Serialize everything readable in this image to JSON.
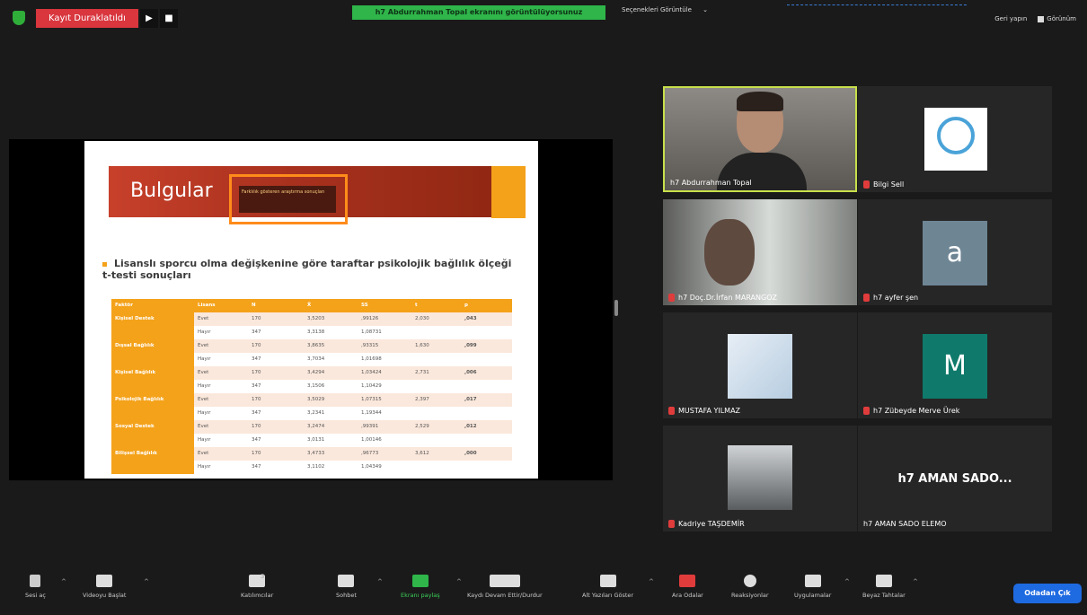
{
  "topbar": {
    "recording_label": "Kayıt Duraklatıldı",
    "play_glyph": "▶",
    "stop_glyph": "■",
    "screen_share_banner": "h7 Abdurrahman Topal ekranını görüntülüyorsunuz",
    "view_options": "Seçenekleri Görüntüle",
    "view_options_caret": "⌄",
    "exit_fullscreen": "Geri yapın",
    "view": "Görünüm"
  },
  "slide": {
    "title": "Bulgular",
    "header_box_text": "Farklılık gösteren araştırma sonuçları",
    "bullet": "Lisanslı sporcu olma değişkenine göre taraftar psikolojik bağlılık ölçeği t-testi sonuçları",
    "table": {
      "headers": [
        "Faktör",
        "Lisans",
        "N",
        "X̄",
        "SS",
        "t",
        "p"
      ],
      "rows": [
        [
          "Kişisel Destek",
          "Evet",
          "170",
          "3,5203",
          ",99126",
          "2,030",
          ",043"
        ],
        [
          "",
          "Hayır",
          "347",
          "3,3138",
          "1,08731",
          "",
          ""
        ],
        [
          "Dışsal Bağlılık",
          "Evet",
          "170",
          "3,8635",
          ",93315",
          "1,630",
          ",099"
        ],
        [
          "",
          "Hayır",
          "347",
          "3,7034",
          "1,01698",
          "",
          ""
        ],
        [
          "Kişisel Bağlılık",
          "Evet",
          "170",
          "3,4294",
          "1,03424",
          "2,731",
          ",006"
        ],
        [
          "",
          "Hayır",
          "347",
          "3,1506",
          "1,10429",
          "",
          ""
        ],
        [
          "Psikolojik Bağlılık",
          "Evet",
          "170",
          "3,5029",
          "1,07315",
          "2,397",
          ",017"
        ],
        [
          "",
          "Hayır",
          "347",
          "3,2341",
          "1,19344",
          "",
          ""
        ],
        [
          "Sosyal Destek",
          "Evet",
          "170",
          "3,2474",
          ",99391",
          "2,529",
          ",012"
        ],
        [
          "",
          "Hayır",
          "347",
          "3,0131",
          "1,00146",
          "",
          ""
        ],
        [
          "Bilişsel Bağlılık",
          "Evet",
          "170",
          "3,4733",
          ",96773",
          "3,612",
          ",000"
        ],
        [
          "",
          "Hayır",
          "347",
          "3,1102",
          "1,04349",
          "",
          ""
        ]
      ]
    }
  },
  "gallery": [
    {
      "name": "h7 Abdurrahman Topal",
      "muted": false
    },
    {
      "name": "Bilgi Sell",
      "muted": true
    },
    {
      "name": "h7 Doç.Dr.İrfan MARANGOZ",
      "muted": true
    },
    {
      "name": "h7 ayfer şen",
      "muted": true,
      "avatar_letter": "a"
    },
    {
      "name": "MUSTAFA YILMAZ",
      "muted": true
    },
    {
      "name": "h7 Zübeyde Merve Ürek",
      "muted": true,
      "avatar_letter": "M"
    },
    {
      "name": "Kadriye TAŞDEMİR",
      "muted": true
    },
    {
      "name": "h7 AMAN SADO ELEMO",
      "muted": false,
      "big_label": "h7 AMAN SADO..."
    }
  ],
  "toolbar": {
    "mic": "Sesi aç",
    "video": "Videoyu Başlat",
    "participants": "Katılımcılar",
    "participants_count": "3",
    "chat": "Sohbet",
    "share": "Ekranı paylaş",
    "record": "Kaydı Devam Ettir/Durdur",
    "captions": "Alt Yazıları Göster",
    "breakout": "Ara Odalar",
    "reactions": "Reaksiyonlar",
    "apps": "Uygulamalar",
    "whiteboard": "Beyaz Tahtalar",
    "leave": "Odadan Çık",
    "caret": "^"
  },
  "colors": {
    "accent_red": "#d9363e",
    "share_green": "#2fb54a",
    "leave_blue": "#1e6ae1",
    "active_speaker": "#c8e04a",
    "slide_orange": "#f4a21a"
  }
}
